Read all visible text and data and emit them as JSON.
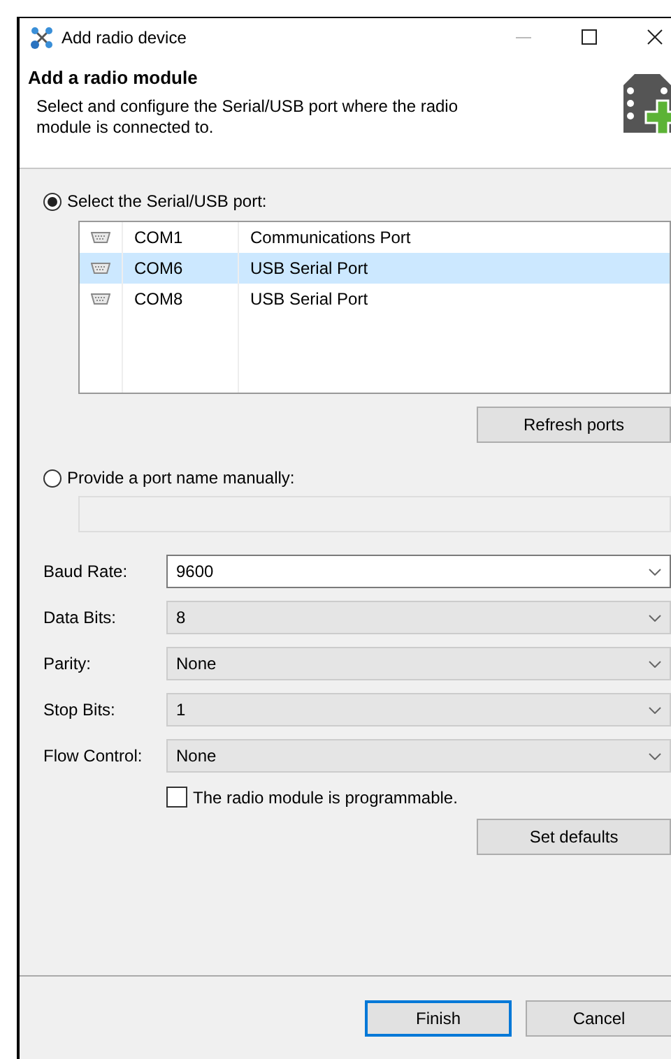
{
  "window": {
    "title": "Add radio device"
  },
  "header": {
    "title": "Add a radio module",
    "description": "Select and configure the Serial/USB port where the radio module is connected to."
  },
  "port_modes": [
    {
      "label": "Select the Serial/USB port:",
      "selected": true
    },
    {
      "label": "Provide a port name manually:",
      "selected": false
    }
  ],
  "ports": [
    {
      "name": "COM1",
      "description": "Communications Port",
      "selected": false
    },
    {
      "name": "COM6",
      "description": "USB Serial Port",
      "selected": true
    },
    {
      "name": "COM8",
      "description": "USB Serial Port",
      "selected": false
    }
  ],
  "refresh_button": "Refresh ports",
  "settings": [
    {
      "label": "Baud Rate:",
      "value": "9600",
      "disabled": false
    },
    {
      "label": "Data Bits:",
      "value": "8",
      "disabled": true
    },
    {
      "label": "Parity:",
      "value": "None",
      "disabled": true
    },
    {
      "label": "Stop Bits:",
      "value": "1",
      "disabled": true
    },
    {
      "label": "Flow Control:",
      "value": "None",
      "disabled": true
    }
  ],
  "programmable": {
    "label": "The radio module is programmable.",
    "checked": false
  },
  "defaults_button": "Set defaults",
  "buttons": [
    {
      "label": "Finish",
      "kind": "default"
    },
    {
      "label": "Cancel",
      "kind": "normal"
    }
  ]
}
